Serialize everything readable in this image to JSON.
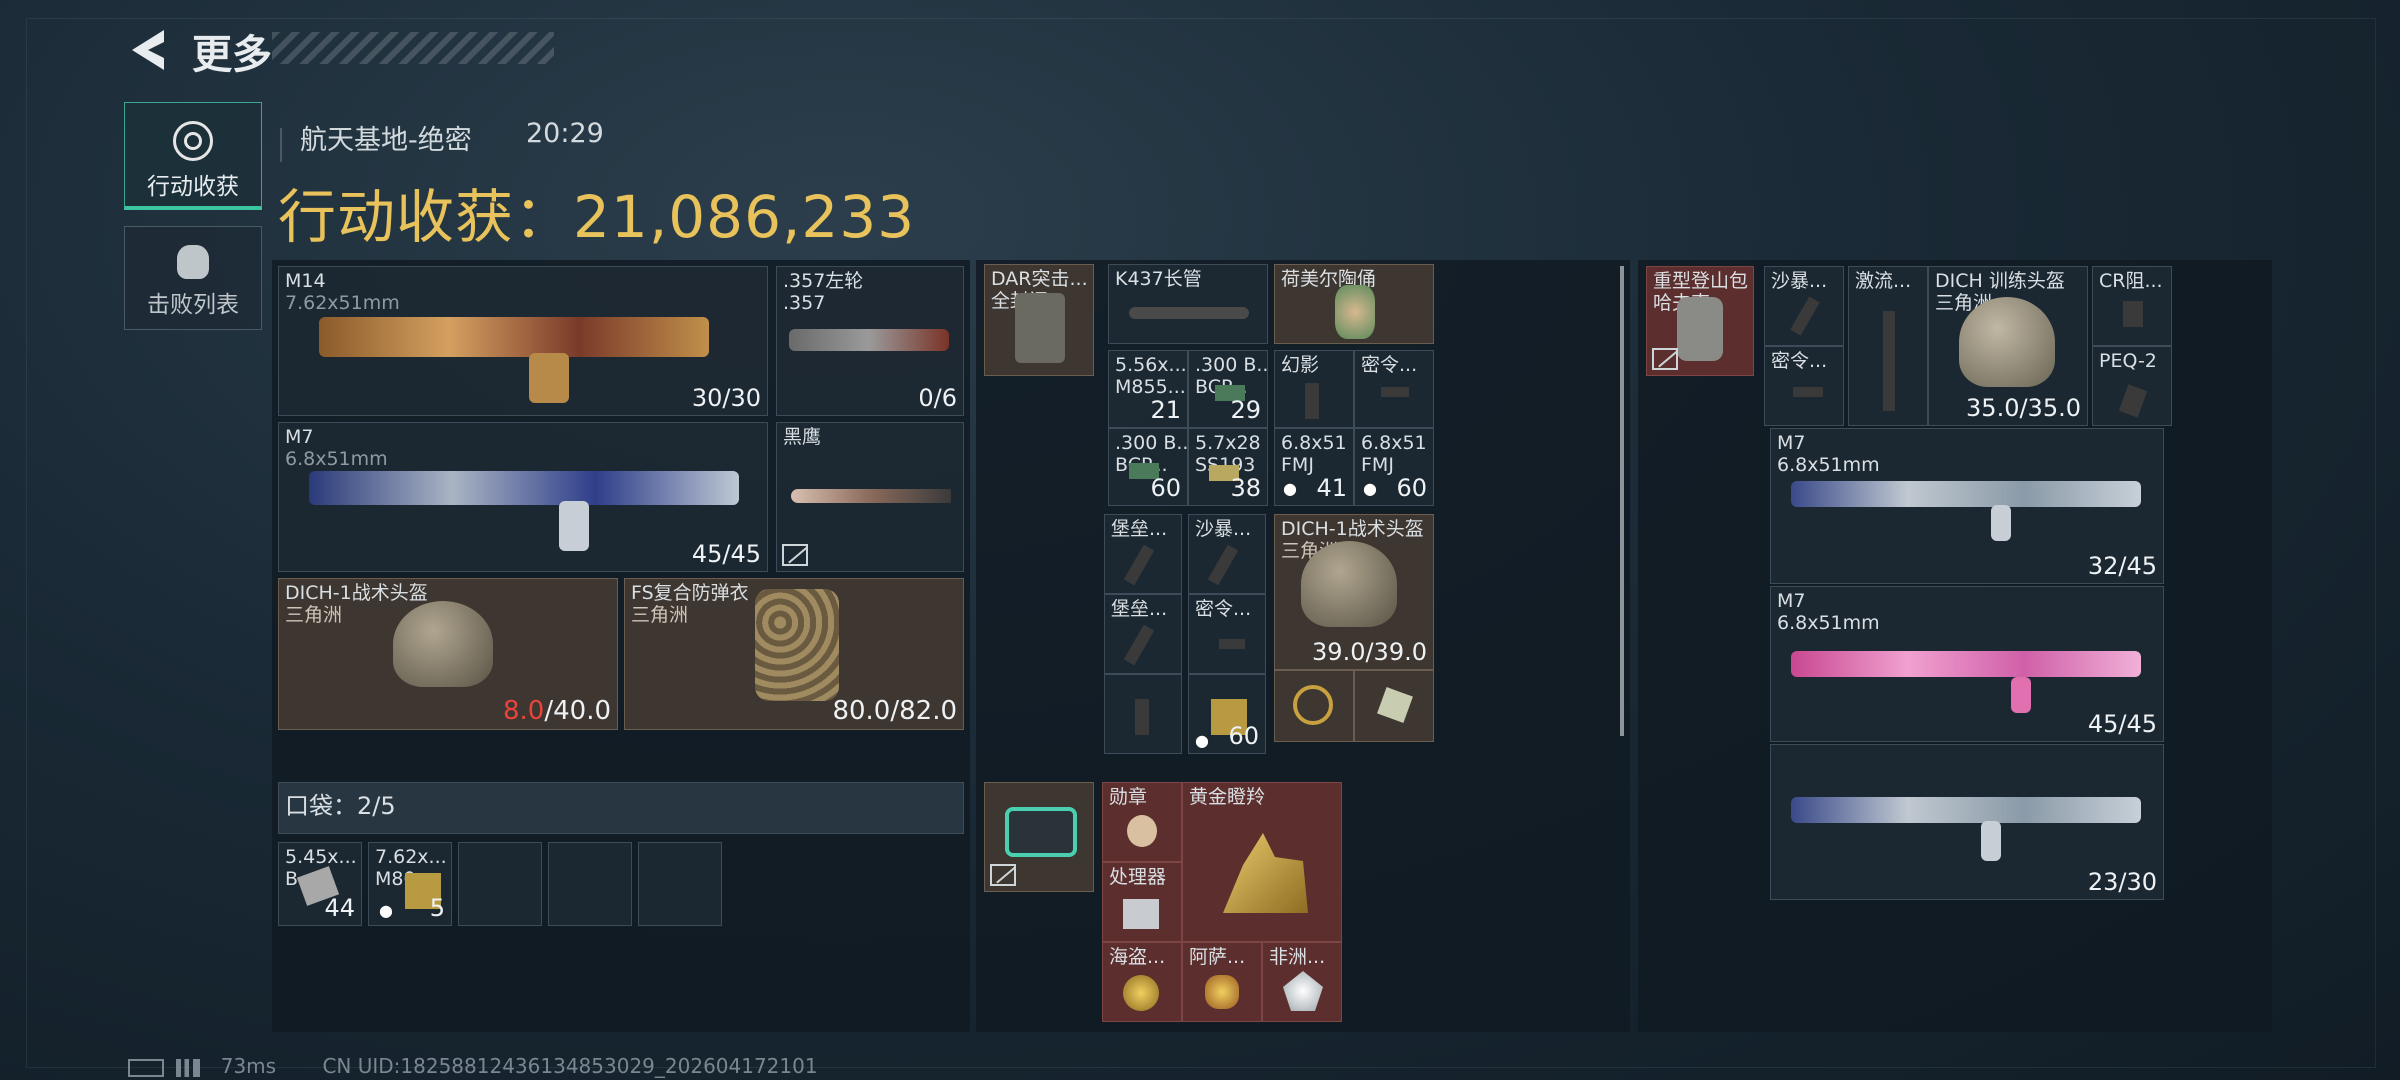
{
  "header": {
    "title": "更多",
    "map": "航天基地-绝密",
    "time": "20:29",
    "yield_label": "行动收获",
    "yield_sep": "：",
    "yield_value": "21,086,233"
  },
  "tabs": [
    {
      "label": "行动收获",
      "active": true
    },
    {
      "label": "击败列表",
      "active": false
    }
  ],
  "loadout": {
    "m14": {
      "name": "M14",
      "caliber": "7.62x51mm",
      "ammo": "30/30"
    },
    "revolver": {
      "name": ".357左轮",
      "caliber": ".357",
      "ammo": "0/6"
    },
    "m7": {
      "name": "M7",
      "caliber": "6.8x51mm",
      "ammo": "45/45"
    },
    "knife": {
      "name": "黑鹰"
    },
    "helmet": {
      "name": "DICH-1战术头盔",
      "sub": "三角洲",
      "dur_now": "8.0",
      "dur_max": "/40.0"
    },
    "armor": {
      "name": "FS复合防弹衣",
      "sub": "三角洲",
      "dur": "80.0/82.0"
    },
    "pocket": {
      "label": "口袋：",
      "count": "2/5"
    },
    "pocket_items": [
      {
        "l1": "5.45x...",
        "l2": "B",
        "n": "44"
      },
      {
        "l1": "7.62x...",
        "l2": "M80",
        "n": "5"
      }
    ]
  },
  "chest": {
    "dar": {
      "l1": "DAR突击...",
      "l2": "全封闭..."
    },
    "k437": {
      "name": "K437长管"
    },
    "doll": {
      "name": "荷美尔陶俑"
    },
    "ammo": [
      {
        "l1": "5.56x...",
        "l2": "M855...",
        "n": "21"
      },
      {
        "l1": ".300 B...",
        "l2": "BCP...",
        "n": "29"
      },
      {
        "l1": "幻影",
        "l2": "",
        "n": ""
      },
      {
        "l1": "密令...",
        "l2": "",
        "n": ""
      },
      {
        "l1": ".300 B...",
        "l2": "BCP...",
        "n": "60"
      },
      {
        "l1": "5.7x28",
        "l2": "SS193",
        "n": "38"
      },
      {
        "l1": "6.8x51",
        "l2": "FMJ",
        "n": "41",
        "dot": "●"
      },
      {
        "l1": "6.8x51",
        "l2": "FMJ",
        "n": "60",
        "dot": "●"
      }
    ],
    "small": [
      {
        "l1": "堡垒..."
      },
      {
        "l1": "沙暴..."
      },
      {
        "l1": "堡垒..."
      },
      {
        "l1": "密令..."
      },
      {
        "l1": ""
      },
      {
        "l1": "",
        "n": "60",
        "dot": "●"
      }
    ],
    "helmet2": {
      "name": "DICH-1战术头盔",
      "sub": "三角洲",
      "dur": "39.0/39.0"
    },
    "valuables": {
      "title": "黄金瞪羚",
      "medal": "勋章",
      "cpu": "处理器",
      "pirate": "海盗...",
      "ati": "阿萨...",
      "africa": "非洲..."
    }
  },
  "backpack": {
    "bag": {
      "l1": "重型登山包",
      "l2": "哈夫克"
    },
    "att": [
      {
        "l1": "沙暴..."
      },
      {
        "l1": "密令..."
      },
      {
        "l1": "激流..."
      }
    ],
    "helmet3": {
      "name": "DICH 训练头盔",
      "sub": "三角洲",
      "dur": "35.0/35.0"
    },
    "cr": {
      "l1": "CR阻..."
    },
    "peq": {
      "l1": "PEQ-2"
    },
    "guns": [
      {
        "name": "M7",
        "caliber": "6.8x51mm",
        "ammo": "32/45"
      },
      {
        "name": "M7",
        "caliber": "6.8x51mm",
        "ammo": "45/45"
      },
      {
        "name": "",
        "caliber": "",
        "ammo": "23/30"
      }
    ]
  },
  "status": {
    "ping": "73ms",
    "uid": "CN UID:1825881243613485302​9_202604172101"
  }
}
